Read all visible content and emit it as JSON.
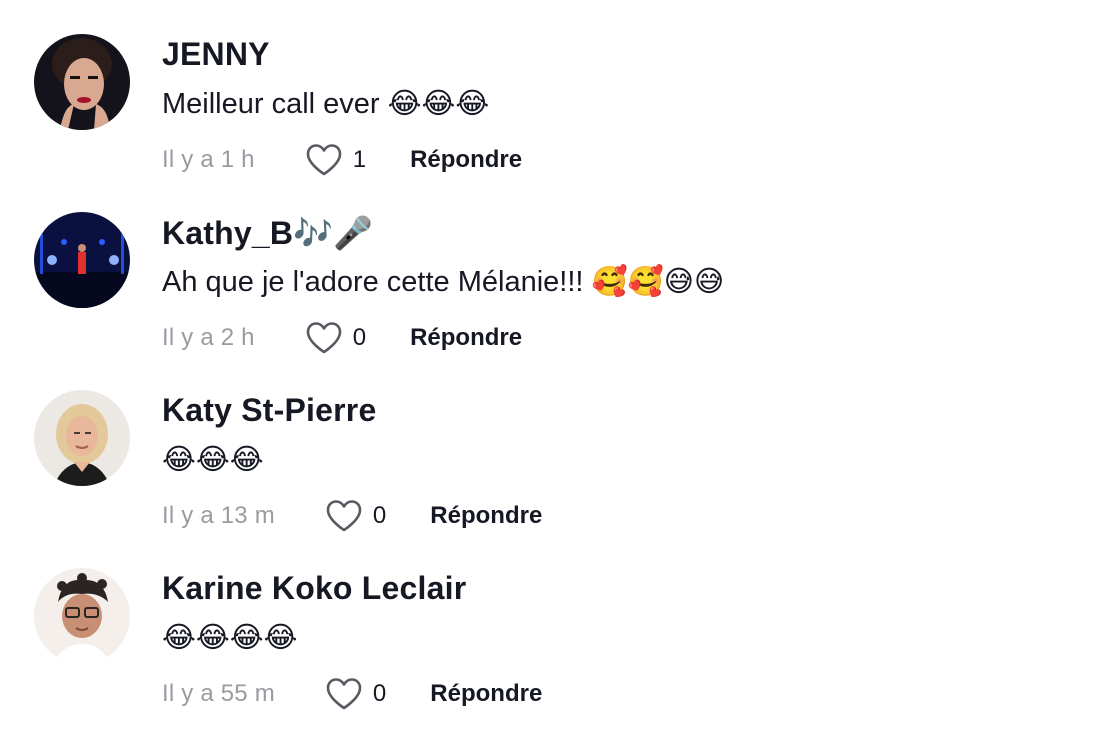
{
  "comments": [
    {
      "username": "JENNY",
      "text": "Meilleur call ever 😂😂😂",
      "time": "Il y a 1 h",
      "likes": "1",
      "reply_label": "Répondre",
      "avatar_colors": {
        "bg": "#14121a",
        "skin": "#d9a891",
        "hair": "#2b1d1a",
        "accent": "#a3122a"
      }
    },
    {
      "username": "Kathy_B🎶🎤",
      "text": "Ah que je l'adore cette Mélanie!!! 🥰🥰😅😅",
      "time": "Il y a 2 h",
      "likes": "0",
      "reply_label": "Répondre",
      "avatar_colors": {
        "bg": "#0a1040",
        "skin": "#2a5cff",
        "hair": "#e0302e",
        "accent": "#8fb2ff"
      }
    },
    {
      "username": "Katy St-Pierre",
      "text": "😂😂😂",
      "time": "Il y a 13 m",
      "likes": "0",
      "reply_label": "Répondre",
      "avatar_colors": {
        "bg": "#ece8e4",
        "skin": "#e8b79c",
        "hair": "#e3c89a",
        "accent": "#1c1c1c"
      }
    },
    {
      "username": "Karine Koko Leclair",
      "text": "😂😂😂😂",
      "time": "Il y a 55 m",
      "likes": "0",
      "reply_label": "Répondre",
      "avatar_colors": {
        "bg": "#f4efea",
        "skin": "#c98f74",
        "hair": "#2a2522",
        "accent": "#ffffff"
      }
    }
  ],
  "colors": {
    "username": "#161823",
    "text": "#161823",
    "time": "#9a9ba1",
    "heart_stroke": "#5a5b62"
  },
  "icons": {
    "like": "heart-outline-icon"
  }
}
